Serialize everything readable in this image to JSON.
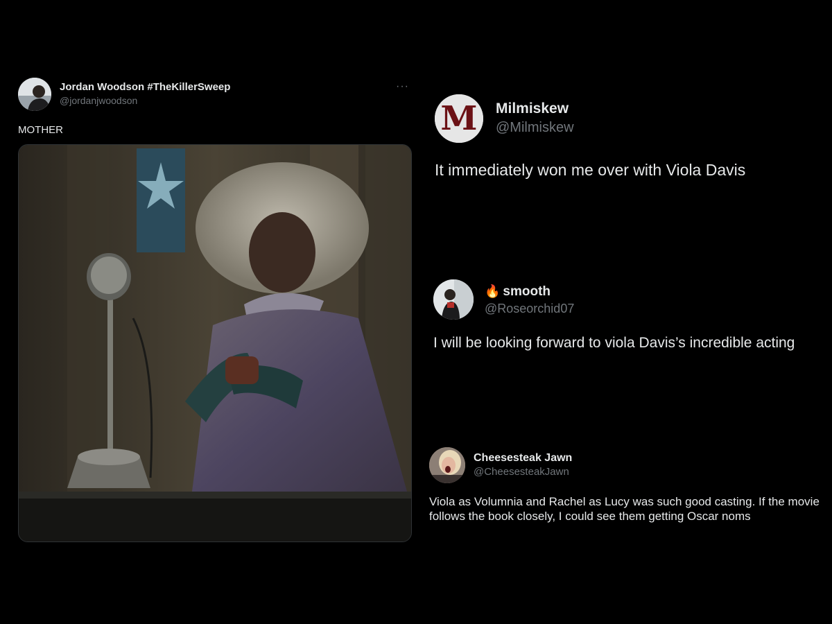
{
  "tweets": [
    {
      "display_name": "Jordan Woodson #TheKillerSweep",
      "handle": "@jordanjwoodson",
      "text": "MOTHER",
      "more_label": "···"
    },
    {
      "display_name": "Milmiskew",
      "handle": "@Milmiskew",
      "avatar_letter": "M",
      "text": "It immediately won me over with Viola Davis"
    },
    {
      "emoji": "🔥",
      "display_name": "smooth",
      "handle": "@Roseorchid07",
      "text": "I will be looking forward to viola Davis’s incredible acting"
    },
    {
      "display_name": "Cheesesteak Jawn",
      "handle": "@CheesesteakJawn",
      "text": "Viola as Volumnia and Rachel as Lucy was such good casting. If the movie follows the book closely, I could see them getting Oscar noms"
    }
  ],
  "colors": {
    "background": "#000000",
    "text": "#e7e9ea",
    "handle": "#71767b",
    "border": "#2f3336"
  }
}
